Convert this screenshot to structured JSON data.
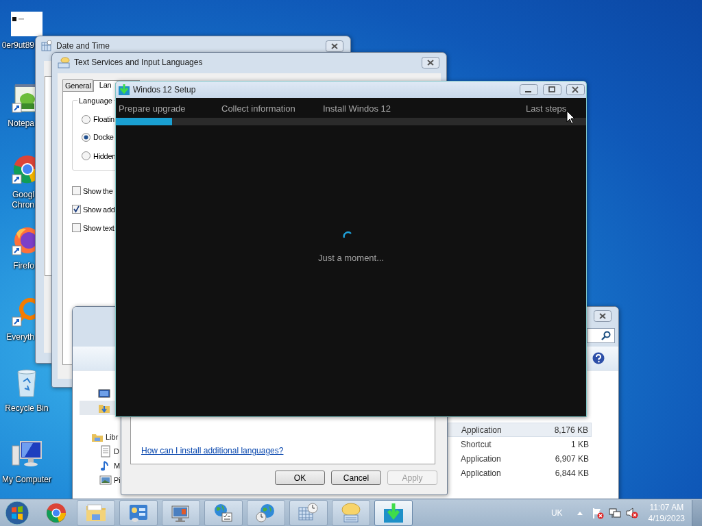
{
  "desktop_icons": [
    {
      "kind": "image-file",
      "label": "0er9ut89",
      "clipped": true
    },
    {
      "kind": "notepad",
      "label": "Notepa",
      "clipped": true
    },
    {
      "kind": "chrome",
      "label": "Googl Chron",
      "clipped": true
    },
    {
      "kind": "firefox",
      "label": "Firefo",
      "clipped": true
    },
    {
      "kind": "everything",
      "label": "Everyth",
      "clipped": true
    },
    {
      "kind": "recycle-bin",
      "label": "Recycle Bin",
      "clipped": false
    },
    {
      "kind": "computer",
      "label": "My Computer",
      "clipped": false
    }
  ],
  "date_and_time": {
    "title": "Date and Time"
  },
  "text_services": {
    "title": "Text Services and Input Languages",
    "tabs": [
      {
        "label": "General",
        "selected": false
      },
      {
        "label": "Lan",
        "selected": true
      }
    ],
    "group_label": "Language",
    "radios": [
      {
        "label": "Floatin",
        "selected": false
      },
      {
        "label": "Docke",
        "selected": true
      },
      {
        "label": "Hidden",
        "selected": false
      }
    ],
    "checkboxes": [
      {
        "label": "Show the",
        "checked": false
      },
      {
        "label": "Show add",
        "checked": true
      },
      {
        "label": "Show text",
        "checked": false
      }
    ]
  },
  "language_dialog": {
    "link": "How can I install additional languages?",
    "buttons": [
      {
        "label": "OK",
        "disabled": false
      },
      {
        "label": "Cancel",
        "disabled": false
      },
      {
        "label": "Apply",
        "disabled": true
      }
    ]
  },
  "explorer": {
    "nav_items": [
      {
        "kind": "desktop",
        "selected": false
      },
      {
        "kind": "downloads",
        "selected": true
      },
      {
        "kind": "libraries",
        "label": "Libr",
        "selected": false,
        "children": [
          {
            "kind": "documents",
            "label": "D",
            "selected": false
          },
          {
            "kind": "music",
            "label": "M",
            "selected": false
          },
          {
            "kind": "pictures",
            "label": "Pi",
            "selected": false
          }
        ]
      }
    ],
    "rows": [
      {
        "type": "Application",
        "size": "8,176 KB",
        "selected": true
      },
      {
        "type": "Shortcut",
        "size": "1 KB",
        "selected": false
      },
      {
        "type": "Application",
        "size": "6,907 KB",
        "selected": false
      },
      {
        "type": "Application",
        "size": "6,844 KB",
        "selected": false
      }
    ]
  },
  "setup": {
    "title": "Windos 12 Setup",
    "steps": [
      "Prepare upgrade",
      "Collect information",
      "Install Windos 12",
      "Last steps"
    ],
    "progress": {
      "level": 0.12
    },
    "status": "Just a moment..."
  },
  "taskbar": {
    "pinned": [
      {
        "kind": "chrome"
      }
    ],
    "buttons": [
      {
        "kind": "folder",
        "selected": false
      },
      {
        "kind": "control-panel",
        "selected": false
      },
      {
        "kind": "monitor",
        "selected": false
      },
      {
        "kind": "globe-list",
        "selected": false
      },
      {
        "kind": "globe-clock",
        "selected": false
      },
      {
        "kind": "calendar",
        "selected": false
      },
      {
        "kind": "speech",
        "selected": false
      },
      {
        "kind": "download",
        "selected": true
      }
    ],
    "language": "UK",
    "time": "11:07 AM",
    "date": "4/19/2023"
  }
}
